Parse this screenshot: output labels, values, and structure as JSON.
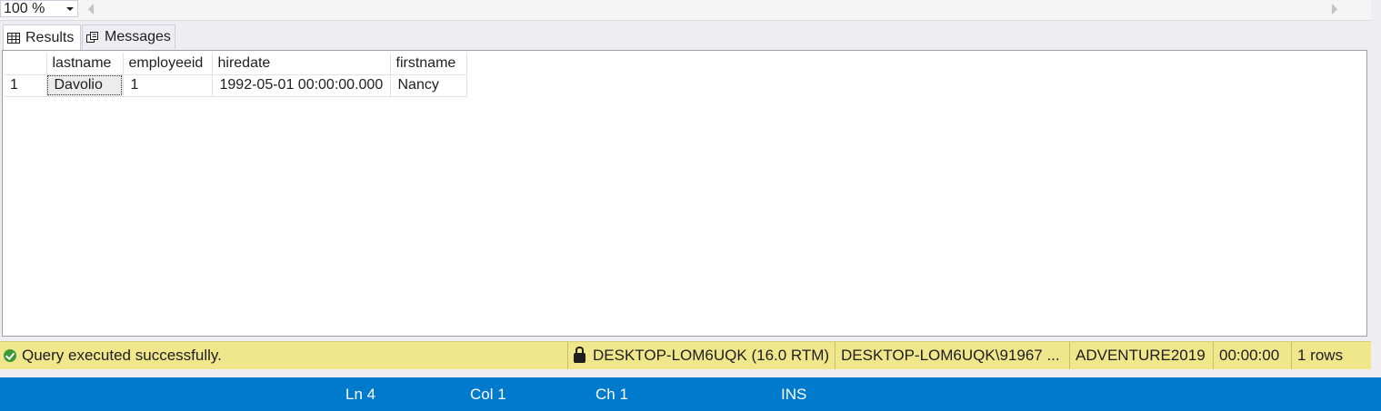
{
  "zoom": {
    "value": "100 %"
  },
  "tabs": [
    {
      "label": "Results",
      "icon": "grid-icon"
    },
    {
      "label": "Messages",
      "icon": "messages-icon"
    }
  ],
  "grid": {
    "columns": [
      "lastname",
      "employeeid",
      "hiredate",
      "firstname"
    ],
    "rows": [
      {
        "num": "1",
        "cells": [
          "Davolio",
          "1",
          "1992-05-01 00:00:00.000",
          "Nancy"
        ]
      }
    ]
  },
  "status": {
    "message": "Query executed successfully.",
    "server": "DESKTOP-LOM6UQK (16.0 RTM)",
    "user": "DESKTOP-LOM6UQK\\91967 ...",
    "database": "ADVENTURE2019",
    "elapsed": "00:00:00",
    "rows": "1 rows"
  },
  "editor": {
    "line": "Ln 4",
    "col": "Col 1",
    "ch": "Ch 1",
    "mode": "INS"
  },
  "colors": {
    "status_bg": "#f0e68c",
    "editor_bar": "#007acc",
    "success": "#3a9a3a"
  }
}
